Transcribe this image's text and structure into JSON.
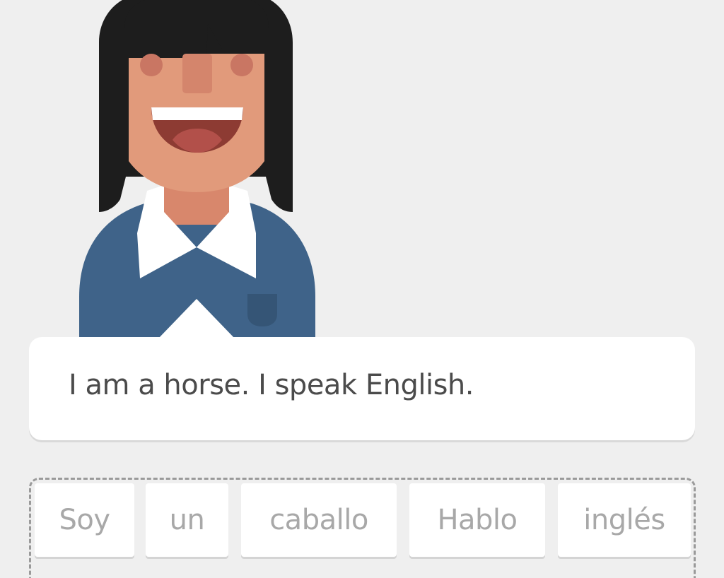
{
  "prompt": {
    "sentence": "I am a horse. I speak English."
  },
  "word_bank": {
    "tiles": [
      "Soy",
      "un",
      "caballo",
      "Hablo",
      "inglés"
    ]
  },
  "colors": {
    "background": "#efefef",
    "hair": "#1d1d1d",
    "skin": "#e19a7b",
    "shirt": "#3f6389",
    "collar": "#ffffff",
    "tile_text": "#a8a8a8",
    "sentence_text": "#4b4b4b"
  }
}
